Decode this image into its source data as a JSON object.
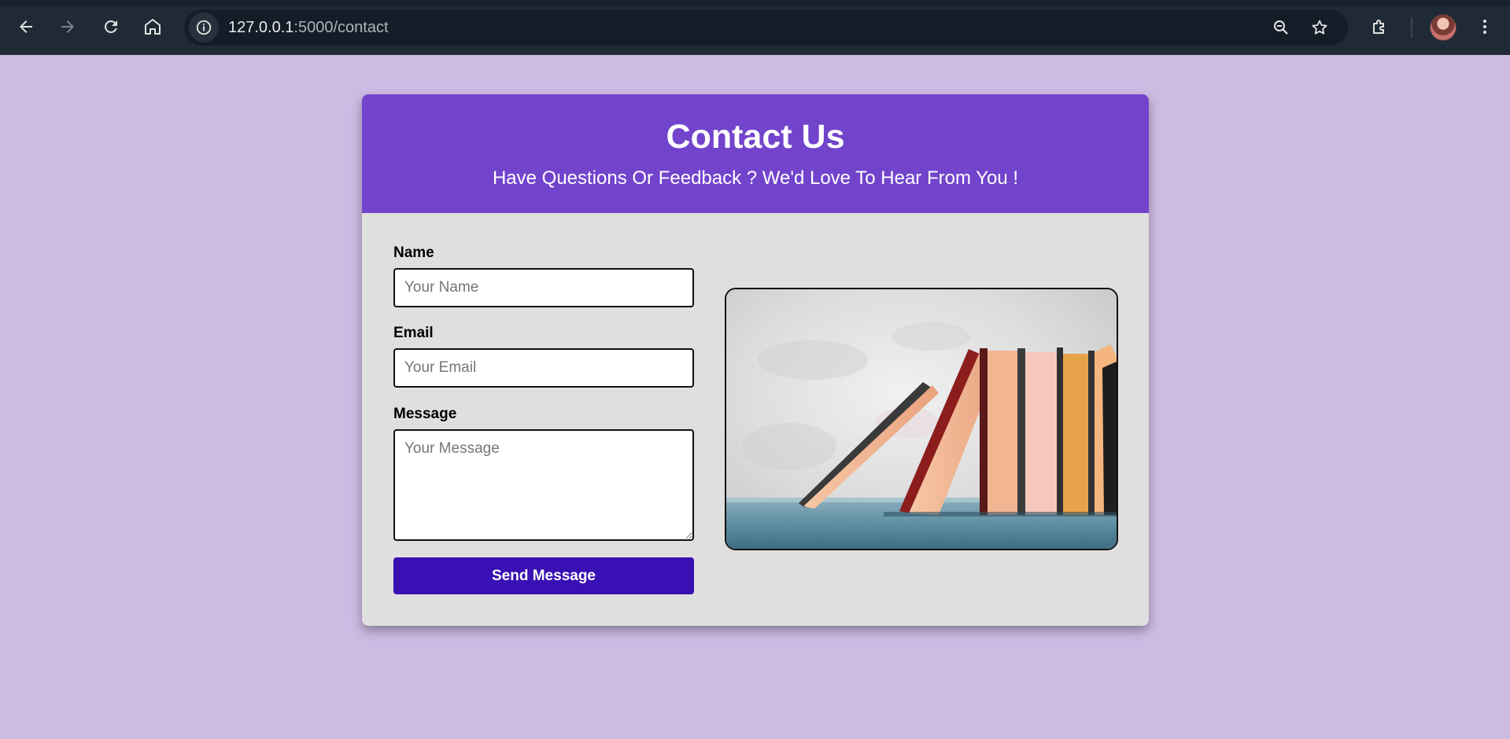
{
  "browser": {
    "url_host": "127.0.0.1",
    "url_path": ":5000/contact",
    "icons": [
      "back-arrow-icon",
      "forward-arrow-icon",
      "reload-icon",
      "home-icon",
      "site-info-icon",
      "zoom-icon",
      "bookmark-star-icon",
      "extensions-icon",
      "profile-avatar",
      "menu-kebab-icon"
    ]
  },
  "page": {
    "title": "Contact Us",
    "subtitle": "Have Questions Or Feedback ? We'd Love To Hear From You !",
    "colors": {
      "background": "#cebbe4",
      "header": "#7244cc",
      "card": "#dfdfdf",
      "button": "#3910b4"
    }
  },
  "form": {
    "name_label": "Name",
    "name_placeholder": "Your Name",
    "email_label": "Email",
    "email_placeholder": "Your Email",
    "message_label": "Message",
    "message_placeholder": "Your Message",
    "submit_label": "Send Message"
  },
  "image": {
    "subject": "books-leaning-on-shelf"
  }
}
